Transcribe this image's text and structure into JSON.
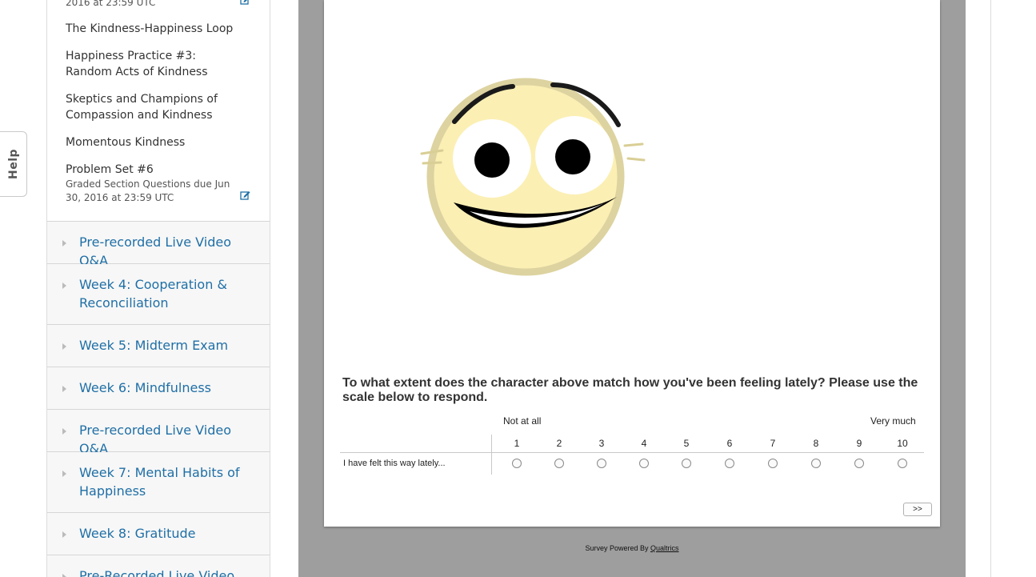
{
  "help": {
    "label": "Help"
  },
  "nav": {
    "top_due": "2016 at 23:59 UTC",
    "subsections": [
      {
        "label": "The Kindness-Happiness Loop"
      },
      {
        "label": "Happiness Practice #3: Random Acts of Kindness"
      },
      {
        "label": "Skeptics and Champions of Compassion and Kindness"
      },
      {
        "label": "Momentous Kindness"
      },
      {
        "label": "Problem Set #6",
        "due": "Graded Section Questions due Jun 30, 2016 at 23:59 UTC"
      }
    ],
    "chapters": [
      {
        "label": "Pre-recorded Live Video Q&A"
      },
      {
        "label": "Week 4: Cooperation & Reconciliation"
      },
      {
        "label": "Week 5: Midterm Exam"
      },
      {
        "label": "Week 6: Mindfulness"
      },
      {
        "label": "Pre-recorded Live Video Q&A"
      },
      {
        "label": "Week 7: Mental Habits of Happiness"
      },
      {
        "label": "Week 8: Gratitude"
      },
      {
        "label": "Pre-Recorded Live Video Q&A"
      }
    ]
  },
  "survey": {
    "question": "To what extent does the character above match how you've been feeling lately? Please use the scale below to respond.",
    "anchor_low": "Not at all",
    "anchor_high": "Very much",
    "scale": [
      "1",
      "2",
      "3",
      "4",
      "5",
      "6",
      "7",
      "8",
      "9",
      "10"
    ],
    "row_label": "I have felt this way lately...",
    "next_label": ">>",
    "powered_prefix": "Survey Powered By ",
    "powered_link": "Qualtrics"
  },
  "colors": {
    "link_blue": "#1f6fa6",
    "survey_bg": "#9e9e9e",
    "face_fill": "#fbefb4",
    "face_outline": "#ddd3a0"
  },
  "icons": {
    "edit": "edit-icon",
    "chapter_toggle": "caret-right-icon",
    "character": "smiley-face-illustration"
  }
}
